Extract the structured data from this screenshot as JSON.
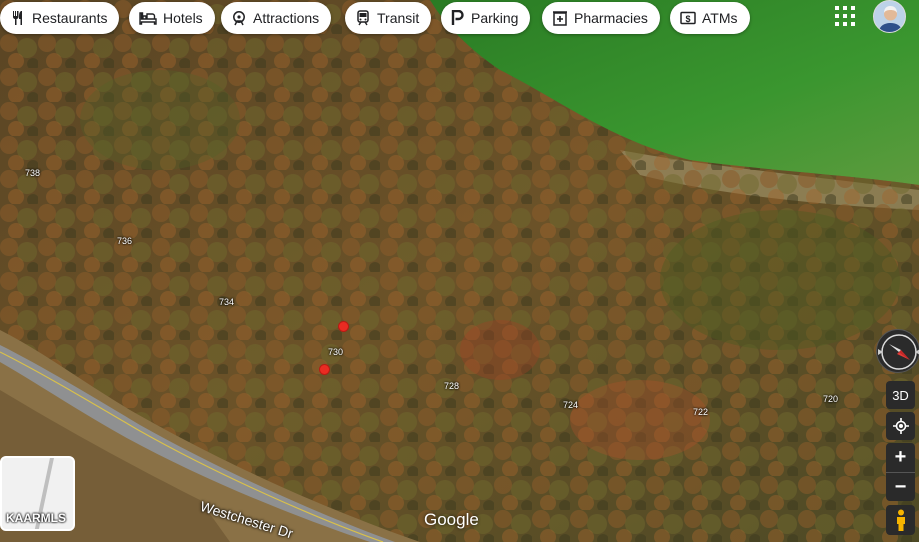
{
  "categories": [
    {
      "label": "Restaurants",
      "icon": "restaurant-icon"
    },
    {
      "label": "Hotels",
      "icon": "hotel-icon"
    },
    {
      "label": "Attractions",
      "icon": "attractions-icon"
    },
    {
      "label": "Transit",
      "icon": "transit-icon"
    },
    {
      "label": "Parking",
      "icon": "parking-icon"
    },
    {
      "label": "Pharmacies",
      "icon": "pharmacy-icon"
    },
    {
      "label": "ATMs",
      "icon": "atm-icon"
    }
  ],
  "header": {
    "apps_icon": "apps-grid-icon",
    "avatar_icon": "user-avatar-icon"
  },
  "elevation_labels": [
    "738",
    "736",
    "734",
    "730",
    "728",
    "724",
    "722",
    "720"
  ],
  "street_name": "Westchester Dr",
  "attribution": "Google",
  "layers": {
    "label": "KAARMLS"
  },
  "controls": {
    "compass_icon": "compass-icon",
    "tilt_label": "3D",
    "locate_icon": "my-location-icon",
    "zoom_in": "+",
    "zoom_out": "−",
    "pegman_icon": "pegman-icon"
  },
  "colors": {
    "pin": "#ea2b22",
    "field": "#2f8c2a",
    "forest": "#5e4a24"
  }
}
